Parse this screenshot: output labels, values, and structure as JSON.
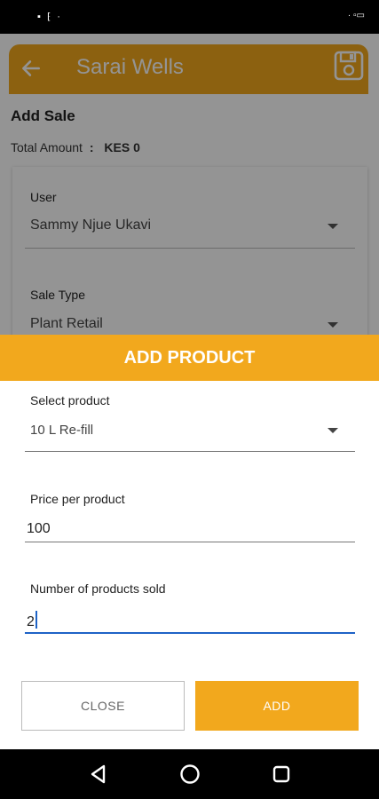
{
  "status_bar": {
    "left_icons": "▪ ⁅ ·",
    "right_icons": "· ▫▭"
  },
  "app_bar": {
    "title": "Sarai Wells",
    "back_icon": "arrow-left-icon",
    "save_icon": "floppy-disk-icon"
  },
  "page": {
    "title": "Add Sale",
    "total_label": "Total Amount",
    "total_separator": ":",
    "total_value": "KES 0"
  },
  "form": {
    "user_label": "User",
    "user_value": "Sammy Njue Ukavi",
    "sale_type_label": "Sale Type",
    "sale_type_value": "Plant Retail"
  },
  "dialog": {
    "title": "ADD PRODUCT",
    "select_product_label": "Select product",
    "select_product_value": "10 L Re-fill",
    "price_label": "Price per product",
    "price_value": "100",
    "quantity_label": "Number of products sold",
    "quantity_value": "2",
    "close_label": "CLOSE",
    "add_label": "ADD"
  },
  "colors": {
    "accent": "#f2a81d",
    "focus": "#1e63c6"
  }
}
